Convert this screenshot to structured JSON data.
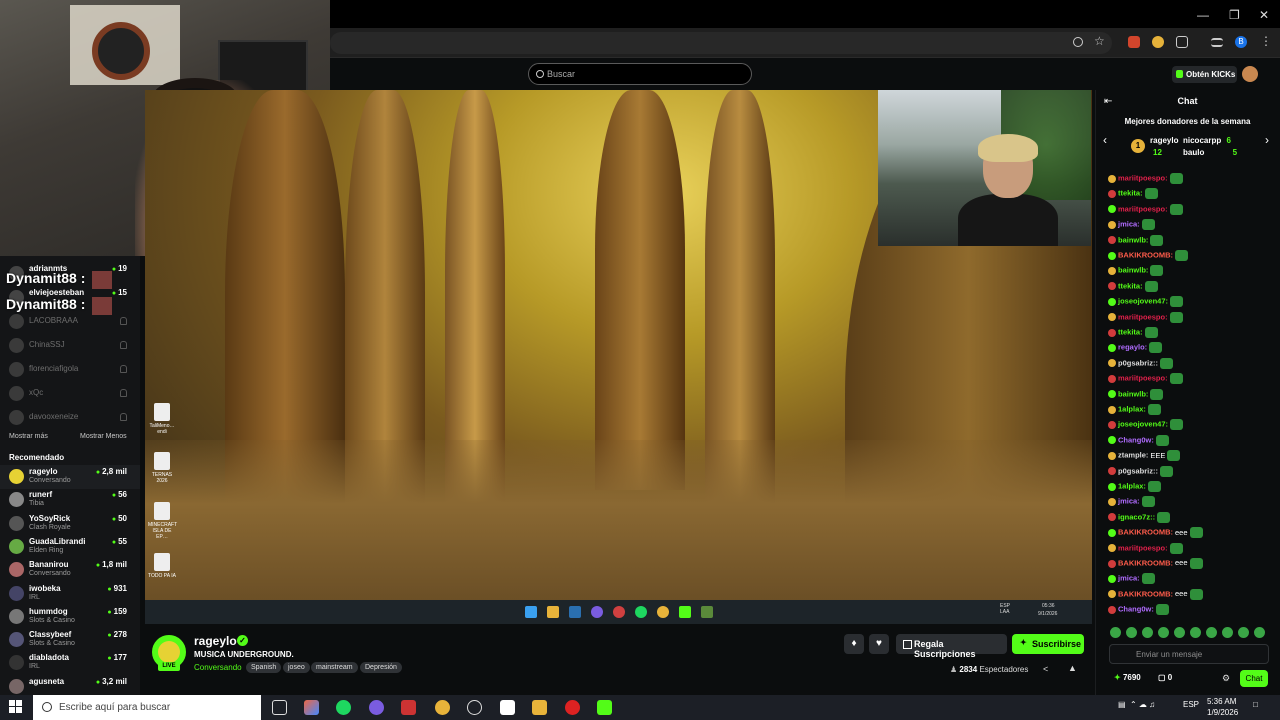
{
  "browser": {
    "search_placeholder": "Buscar",
    "obtain_kicks": "Obtén KICKs",
    "profile_initial": "B"
  },
  "sidebar": {
    "following": [
      {
        "name": "adrianmts",
        "viewers": "19",
        "live": true
      },
      {
        "name": "elviejoesteban",
        "viewers": "15",
        "live": true
      },
      {
        "name": "LACOBRAAA",
        "live": false
      },
      {
        "name": "ChinaSSJ",
        "live": false
      },
      {
        "name": "florenciafigola",
        "live": false
      },
      {
        "name": "xQc",
        "live": false
      },
      {
        "name": "davooxeneize",
        "live": false
      }
    ],
    "overlay": [
      "Dynamit88 :",
      "Dynamit88 :"
    ],
    "show_more": "Mostrar más",
    "show_less": "Mostrar Menos",
    "recommended_label": "Recomendado",
    "recommended": [
      {
        "name": "rageylo",
        "game": "Conversando",
        "viewers": "2,8 mil"
      },
      {
        "name": "runerf",
        "game": "Tibia",
        "viewers": "56"
      },
      {
        "name": "YoSoyRick",
        "game": "Clash Royale",
        "viewers": "50"
      },
      {
        "name": "GuadaLibrandi",
        "game": "Elden Ring",
        "viewers": "55"
      },
      {
        "name": "Bananirou",
        "game": "Conversando",
        "viewers": "1,8 mil"
      },
      {
        "name": "iwobeka",
        "game": "IRL",
        "viewers": "931"
      },
      {
        "name": "hummdog",
        "game": "Slots & Casino",
        "viewers": "159"
      },
      {
        "name": "Classybeef",
        "game": "Slots & Casino",
        "viewers": "278"
      },
      {
        "name": "diabladota",
        "game": "IRL",
        "viewers": "177"
      },
      {
        "name": "agusneta",
        "game": "",
        "viewers": "3,2 mil"
      }
    ]
  },
  "desktop_icons": [
    "TaliMeno… endi",
    "TERNAS 2026",
    "MINECRAFT ISLA DE EP…",
    "TODO PA IA"
  ],
  "inner_tray": {
    "lang": "ESP LAA",
    "time": "05:36",
    "date": "9/1/2026"
  },
  "stream": {
    "name": "rageylo",
    "live": "LIVE",
    "title": "MUSICA UNDERGROUND.",
    "category": "Conversando",
    "tags": [
      "Spanish",
      "joseo",
      "mainstream",
      "Depresión"
    ],
    "gift_label": "Regala Suscripciones",
    "subscribe_label": "Suscribirse",
    "viewers": "2834",
    "viewers_label": "Espectadores"
  },
  "chat": {
    "title": "Chat",
    "donors_title": "Mejores donadores de la semana",
    "donors": [
      {
        "name": "rageylo",
        "amount": "12"
      },
      {
        "name": "nicocarpp",
        "amount": "6"
      },
      {
        "name": "baulo",
        "amount": "5"
      }
    ],
    "rank": "1",
    "messages": [
      {
        "user": "mariitpoespo:",
        "color": "#e0204a",
        "text": ""
      },
      {
        "user": "ttekita:",
        "color": "#53fc18",
        "text": ""
      },
      {
        "user": "mariitpoespo:",
        "color": "#e0204a",
        "text": ""
      },
      {
        "user": "jmica:",
        "color": "#b06cff",
        "text": ""
      },
      {
        "user": "bainwlb:",
        "color": "#53fc18",
        "text": ""
      },
      {
        "user": "BAKIKROOMB:",
        "color": "#ff5c4b",
        "text": ""
      },
      {
        "user": "bainwlb:",
        "color": "#53fc18",
        "text": ""
      },
      {
        "user": "ttekita:",
        "color": "#53fc18",
        "text": ""
      },
      {
        "user": "joseojoven47:",
        "color": "#53fc18",
        "text": ""
      },
      {
        "user": "mariitpoespo:",
        "color": "#e0204a",
        "text": ""
      },
      {
        "user": "ttekita:",
        "color": "#53fc18",
        "text": ""
      },
      {
        "user": "regaylo:",
        "color": "#b06cff",
        "text": ""
      },
      {
        "user": "p0gsabriz::",
        "color": "#dddddd",
        "text": ""
      },
      {
        "user": "mariitpoespo:",
        "color": "#e0204a",
        "text": ""
      },
      {
        "user": "bainwlb:",
        "color": "#53fc18",
        "text": ""
      },
      {
        "user": "1alplax:",
        "color": "#53fc18",
        "text": ""
      },
      {
        "user": "joseojoven47:",
        "color": "#53fc18",
        "text": ""
      },
      {
        "user": "Chang0w:",
        "color": "#b06cff",
        "text": ""
      },
      {
        "user": "ztample:",
        "color": "#dddddd",
        "text": "EEE"
      },
      {
        "user": "p0gsabriz::",
        "color": "#dddddd",
        "text": ""
      },
      {
        "user": "1alplax:",
        "color": "#53fc18",
        "text": ""
      },
      {
        "user": "jmica:",
        "color": "#b06cff",
        "text": ""
      },
      {
        "user": "ignaco7z::",
        "color": "#53fc18",
        "text": ""
      },
      {
        "user": "BAKIKROOMB:",
        "color": "#ff5c4b",
        "text": "eee"
      },
      {
        "user": "mariitpoespo:",
        "color": "#e0204a",
        "text": ""
      },
      {
        "user": "BAKIKROOMB:",
        "color": "#ff5c4b",
        "text": "eee"
      },
      {
        "user": "jmica:",
        "color": "#b06cff",
        "text": ""
      },
      {
        "user": "BAKIKROOMB:",
        "color": "#ff5c4b",
        "text": "eee"
      },
      {
        "user": "Chang0w:",
        "color": "#b06cff",
        "text": ""
      }
    ],
    "input_placeholder": "Enviar un mensaje",
    "kicks": "7690",
    "points": "0",
    "chat_button": "Chat"
  },
  "taskbar": {
    "search_placeholder": "Escribe aquí para buscar",
    "lang": "ESP",
    "time": "5:36 AM",
    "date": "1/9/2026"
  },
  "colors": {
    "accent": "#53fc18",
    "bg": "#0b0d0e"
  }
}
